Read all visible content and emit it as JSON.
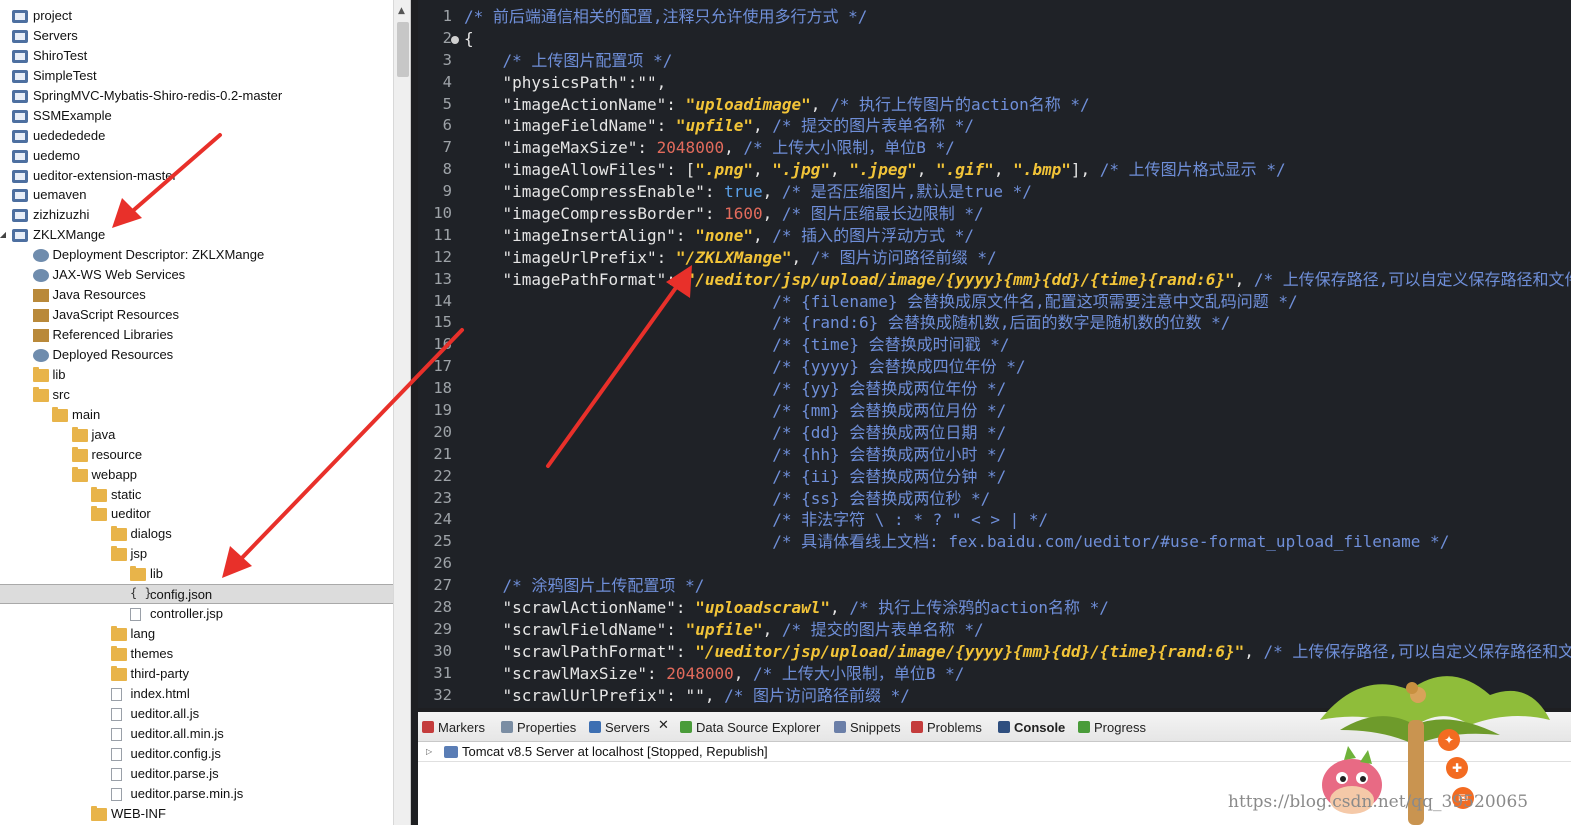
{
  "explorer": {
    "items": [
      {
        "label": "project",
        "depth": 0,
        "twisty": "",
        "icon": "project"
      },
      {
        "label": "Servers",
        "depth": 0,
        "twisty": "",
        "icon": "project"
      },
      {
        "label": "ShiroTest",
        "depth": 0,
        "twisty": "",
        "icon": "project"
      },
      {
        "label": "SimpleTest",
        "depth": 0,
        "twisty": "",
        "icon": "project"
      },
      {
        "label": "SpringMVC-Mybatis-Shiro-redis-0.2-master",
        "depth": 0,
        "twisty": "",
        "icon": "project"
      },
      {
        "label": "SSMExample",
        "depth": 0,
        "twisty": "",
        "icon": "project"
      },
      {
        "label": "uedededede",
        "depth": 0,
        "twisty": "",
        "icon": "project"
      },
      {
        "label": "uedemo",
        "depth": 0,
        "twisty": "",
        "icon": "project"
      },
      {
        "label": "ueditor-extension-master",
        "depth": 0,
        "twisty": "",
        "icon": "project"
      },
      {
        "label": "uemaven",
        "depth": 0,
        "twisty": "",
        "icon": "project"
      },
      {
        "label": "zizhizuzhi",
        "depth": 0,
        "twisty": "",
        "icon": "project"
      },
      {
        "label": "ZKLXMange",
        "depth": 0,
        "twisty": "◢",
        "icon": "project"
      },
      {
        "label": "Deployment Descriptor: ZKLXMange",
        "depth": 1,
        "twisty": "▷",
        "icon": "ws"
      },
      {
        "label": "JAX-WS Web Services",
        "depth": 1,
        "twisty": "▷",
        "icon": "ws"
      },
      {
        "label": "Java Resources",
        "depth": 1,
        "twisty": "▷",
        "icon": "lib"
      },
      {
        "label": "JavaScript Resources",
        "depth": 1,
        "twisty": "▷",
        "icon": "lib"
      },
      {
        "label": "Referenced Libraries",
        "depth": 1,
        "twisty": "▷",
        "icon": "lib"
      },
      {
        "label": "Deployed Resources",
        "depth": 1,
        "twisty": "▷",
        "icon": "ws"
      },
      {
        "label": "lib",
        "depth": 1,
        "twisty": "▷",
        "icon": "folder"
      },
      {
        "label": "src",
        "depth": 1,
        "twisty": "◢",
        "icon": "folder"
      },
      {
        "label": "main",
        "depth": 2,
        "twisty": "◢",
        "icon": "folder"
      },
      {
        "label": "java",
        "depth": 3,
        "twisty": "▷",
        "icon": "folder"
      },
      {
        "label": "resource",
        "depth": 3,
        "twisty": "▷",
        "icon": "folder"
      },
      {
        "label": "webapp",
        "depth": 3,
        "twisty": "◢",
        "icon": "folder"
      },
      {
        "label": "static",
        "depth": 4,
        "twisty": "▷",
        "icon": "folder"
      },
      {
        "label": "ueditor",
        "depth": 4,
        "twisty": "◢",
        "icon": "folder"
      },
      {
        "label": "dialogs",
        "depth": 5,
        "twisty": "▷",
        "icon": "folder"
      },
      {
        "label": "jsp",
        "depth": 5,
        "twisty": "◢",
        "icon": "folder"
      },
      {
        "label": "lib",
        "depth": 6,
        "twisty": "▷",
        "icon": "folder"
      },
      {
        "label": "config.json",
        "depth": 6,
        "twisty": "",
        "icon": "json",
        "selected": true
      },
      {
        "label": "controller.jsp",
        "depth": 6,
        "twisty": "",
        "icon": "file"
      },
      {
        "label": "lang",
        "depth": 5,
        "twisty": "▷",
        "icon": "folder"
      },
      {
        "label": "themes",
        "depth": 5,
        "twisty": "▷",
        "icon": "folder"
      },
      {
        "label": "third-party",
        "depth": 5,
        "twisty": "▷",
        "icon": "folder"
      },
      {
        "label": "index.html",
        "depth": 5,
        "twisty": "",
        "icon": "file"
      },
      {
        "label": "ueditor.all.js",
        "depth": 5,
        "twisty": "▷",
        "icon": "file"
      },
      {
        "label": "ueditor.all.min.js",
        "depth": 5,
        "twisty": "▷",
        "icon": "file"
      },
      {
        "label": "ueditor.config.js",
        "depth": 5,
        "twisty": "▷",
        "icon": "file"
      },
      {
        "label": "ueditor.parse.js",
        "depth": 5,
        "twisty": "▷",
        "icon": "file"
      },
      {
        "label": "ueditor.parse.min.js",
        "depth": 5,
        "twisty": "▷",
        "icon": "file"
      },
      {
        "label": "WEB-INF",
        "depth": 4,
        "twisty": "▷",
        "icon": "folder"
      }
    ]
  },
  "editor": {
    "line_numbers": [
      "1",
      "2",
      "3",
      "4",
      "5",
      "6",
      "7",
      "8",
      "9",
      "10",
      "11",
      "12",
      "13",
      "14",
      "15",
      "16",
      "17",
      "18",
      "19",
      "20",
      "21",
      "22",
      "23",
      "24",
      "25",
      "26",
      "27",
      "28",
      "29",
      "30",
      "31",
      "32"
    ],
    "lines": [
      [
        {
          "t": "cmt",
          "v": "/* 前后端通信相关的配置,注释只允许使用多行方式 */"
        }
      ],
      [
        {
          "t": "key",
          "v": "{"
        }
      ],
      [
        {
          "t": "cmt",
          "v": "    /* 上传图片配置项 */"
        }
      ],
      [
        {
          "t": "key",
          "v": "    \"physicsPath\":\"\","
        }
      ],
      [
        {
          "t": "key",
          "v": "    \"imageActionName\": "
        },
        {
          "t": "str",
          "v": "\"uploadimage\""
        },
        {
          "t": "key",
          "v": ", "
        },
        {
          "t": "cmt",
          "v": "/* 执行上传图片的action名称 */"
        }
      ],
      [
        {
          "t": "key",
          "v": "    \"imageFieldName\": "
        },
        {
          "t": "str",
          "v": "\"upfile\""
        },
        {
          "t": "key",
          "v": ", "
        },
        {
          "t": "cmt",
          "v": "/* 提交的图片表单名称 */"
        }
      ],
      [
        {
          "t": "key",
          "v": "    \"imageMaxSize\": "
        },
        {
          "t": "num",
          "v": "2048000"
        },
        {
          "t": "key",
          "v": ", "
        },
        {
          "t": "cmt",
          "v": "/* 上传大小限制，单位B */"
        }
      ],
      [
        {
          "t": "key",
          "v": "    \"imageAllowFiles\": ["
        },
        {
          "t": "str",
          "v": "\".png\""
        },
        {
          "t": "key",
          "v": ", "
        },
        {
          "t": "str",
          "v": "\".jpg\""
        },
        {
          "t": "key",
          "v": ", "
        },
        {
          "t": "str",
          "v": "\".jpeg\""
        },
        {
          "t": "key",
          "v": ", "
        },
        {
          "t": "str",
          "v": "\".gif\""
        },
        {
          "t": "key",
          "v": ", "
        },
        {
          "t": "str",
          "v": "\".bmp\""
        },
        {
          "t": "key",
          "v": "], "
        },
        {
          "t": "cmt",
          "v": "/* 上传图片格式显示 */"
        }
      ],
      [
        {
          "t": "key",
          "v": "    \"imageCompressEnable\": "
        },
        {
          "t": "kw",
          "v": "true"
        },
        {
          "t": "key",
          "v": ", "
        },
        {
          "t": "cmt",
          "v": "/* 是否压缩图片,默认是true */"
        }
      ],
      [
        {
          "t": "key",
          "v": "    \"imageCompressBorder\": "
        },
        {
          "t": "num",
          "v": "1600"
        },
        {
          "t": "key",
          "v": ", "
        },
        {
          "t": "cmt",
          "v": "/* 图片压缩最长边限制 */"
        }
      ],
      [
        {
          "t": "key",
          "v": "    \"imageInsertAlign\": "
        },
        {
          "t": "str",
          "v": "\"none\""
        },
        {
          "t": "key",
          "v": ", "
        },
        {
          "t": "cmt",
          "v": "/* 插入的图片浮动方式 */"
        }
      ],
      [
        {
          "t": "key",
          "v": "    \"imageUrlPrefix\": "
        },
        {
          "t": "str",
          "v": "\"/ZKLXMange\""
        },
        {
          "t": "key",
          "v": ", "
        },
        {
          "t": "cmt",
          "v": "/* 图片访问路径前缀 */"
        }
      ],
      [
        {
          "t": "key",
          "v": "    \"imagePathFormat\": "
        },
        {
          "t": "str",
          "v": "\"/ueditor/jsp/upload/image/{yyyy}{mm}{dd}/{time}{rand:6}\""
        },
        {
          "t": "key",
          "v": ", "
        },
        {
          "t": "cmt",
          "v": "/* 上传保存路径,可以自定义保存路径和文件名格式 */"
        }
      ],
      [
        {
          "t": "cmt",
          "v": "                                /* {filename} 会替换成原文件名,配置这项需要注意中文乱码问题 */"
        }
      ],
      [
        {
          "t": "cmt",
          "v": "                                /* {rand:6} 会替换成随机数,后面的数字是随机数的位数 */"
        }
      ],
      [
        {
          "t": "cmt",
          "v": "                                /* {time} 会替换成时间戳 */"
        }
      ],
      [
        {
          "t": "cmt",
          "v": "                                /* {yyyy} 会替换成四位年份 */"
        }
      ],
      [
        {
          "t": "cmt",
          "v": "                                /* {yy} 会替换成两位年份 */"
        }
      ],
      [
        {
          "t": "cmt",
          "v": "                                /* {mm} 会替换成两位月份 */"
        }
      ],
      [
        {
          "t": "cmt",
          "v": "                                /* {dd} 会替换成两位日期 */"
        }
      ],
      [
        {
          "t": "cmt",
          "v": "                                /* {hh} 会替换成两位小时 */"
        }
      ],
      [
        {
          "t": "cmt",
          "v": "                                /* {ii} 会替换成两位分钟 */"
        }
      ],
      [
        {
          "t": "cmt",
          "v": "                                /* {ss} 会替换成两位秒 */"
        }
      ],
      [
        {
          "t": "cmt",
          "v": "                                /* 非法字符 \\ : * ? \" < > | */"
        }
      ],
      [
        {
          "t": "cmt",
          "v": "                                /* 具请体看线上文档: fex.baidu.com/ueditor/#use-format_upload_filename */"
        }
      ],
      [
        {
          "t": "key",
          "v": ""
        }
      ],
      [
        {
          "t": "cmt",
          "v": "    /* 涂鸦图片上传配置项 */"
        }
      ],
      [
        {
          "t": "key",
          "v": "    \"scrawlActionName\": "
        },
        {
          "t": "str",
          "v": "\"uploadscrawl\""
        },
        {
          "t": "key",
          "v": ", "
        },
        {
          "t": "cmt",
          "v": "/* 执行上传涂鸦的action名称 */"
        }
      ],
      [
        {
          "t": "key",
          "v": "    \"scrawlFieldName\": "
        },
        {
          "t": "str",
          "v": "\"upfile\""
        },
        {
          "t": "key",
          "v": ", "
        },
        {
          "t": "cmt",
          "v": "/* 提交的图片表单名称 */"
        }
      ],
      [
        {
          "t": "key",
          "v": "    \"scrawlPathFormat\": "
        },
        {
          "t": "str",
          "v": "\"/ueditor/jsp/upload/image/{yyyy}{mm}{dd}/{time}{rand:6}\""
        },
        {
          "t": "key",
          "v": ", "
        },
        {
          "t": "cmt",
          "v": "/* 上传保存路径,可以自定义保存路径和文件名格式 */"
        }
      ],
      [
        {
          "t": "key",
          "v": "    \"scrawlMaxSize\": "
        },
        {
          "t": "num",
          "v": "2048000"
        },
        {
          "t": "key",
          "v": ", "
        },
        {
          "t": "cmt",
          "v": "/* 上传大小限制，单位B */"
        }
      ],
      [
        {
          "t": "key",
          "v": "    \"scrawlUrlPrefix\": \"\", "
        },
        {
          "t": "cmt",
          "v": "/* 图片访问路径前缀 */"
        }
      ]
    ]
  },
  "panel": {
    "tabs": [
      {
        "label": "Markers",
        "icon": "markers-icon"
      },
      {
        "label": "Properties",
        "icon": "properties-icon"
      },
      {
        "label": "Servers",
        "icon": "servers-icon",
        "active": true
      },
      {
        "label": "Data Source Explorer",
        "icon": "data-source-icon"
      },
      {
        "label": "Snippets",
        "icon": "snippets-icon"
      },
      {
        "label": "Problems",
        "icon": "problems-icon"
      },
      {
        "label": "Console",
        "icon": "console-icon"
      },
      {
        "label": "Progress",
        "icon": "progress-icon"
      }
    ],
    "close_glyph": "✕",
    "server_label": "Tomcat v8.5 Server at localhost  [Stopped, Republish]"
  },
  "watermark": "https://blog.csdn.net/qq_39520065",
  "colors": {
    "arrow": "#e8302a",
    "comment": "#6f8fd9",
    "string": "#f2c438",
    "number": "#e36b5c",
    "keyword": "#5aa0e8"
  }
}
